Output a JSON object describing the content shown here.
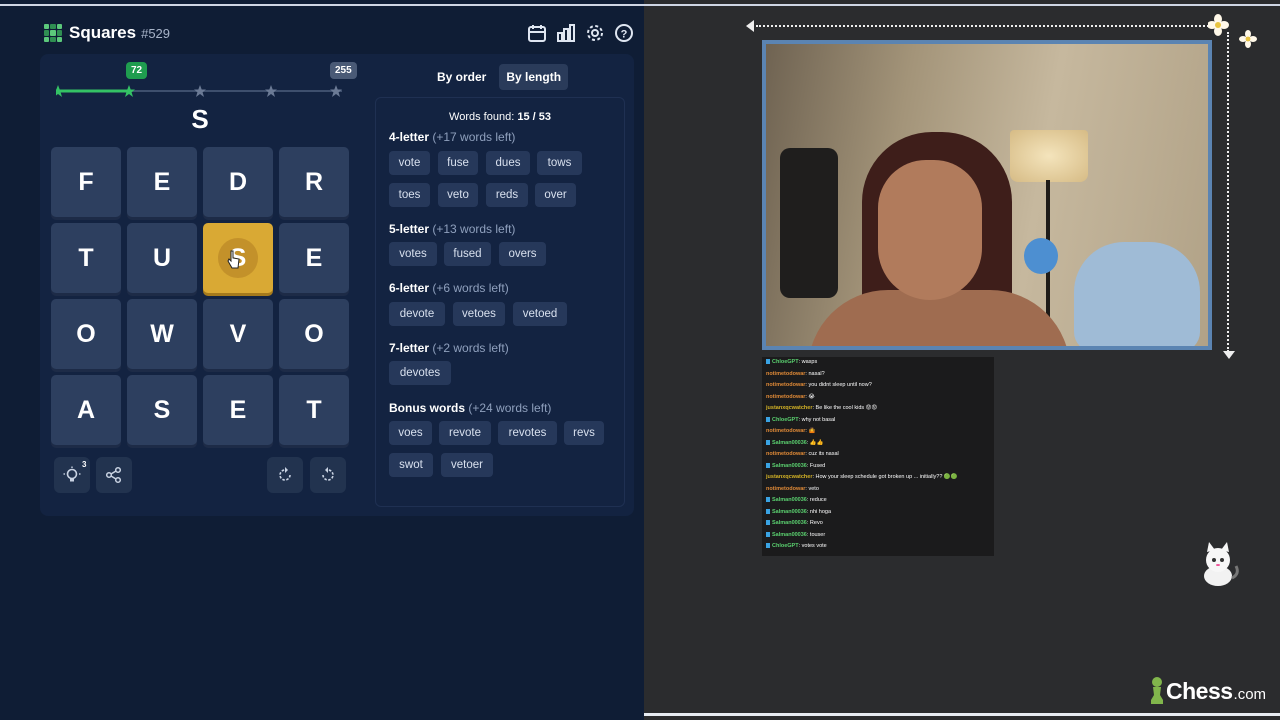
{
  "game": {
    "title": "Squares",
    "number": "#529",
    "progress": {
      "current_score": "72",
      "max_score": "255"
    },
    "current_word": "S",
    "grid": [
      [
        "F",
        "E",
        "D",
        "R"
      ],
      [
        "T",
        "U",
        "S",
        "E"
      ],
      [
        "O",
        "W",
        "V",
        "O"
      ],
      [
        "A",
        "S",
        "E",
        "T"
      ]
    ],
    "selected_tile": "S",
    "hint_count": "3",
    "tabs": {
      "by_order": "By order",
      "by_length": "By length"
    },
    "found": {
      "label": "Words found:",
      "value": "15 / 53"
    },
    "sections": [
      {
        "title": "4-letter",
        "left": "(+17 words left)",
        "words": [
          "vote",
          "fuse",
          "dues",
          "tows",
          "toes",
          "veto",
          "reds",
          "over"
        ]
      },
      {
        "title": "5-letter",
        "left": "(+13 words left)",
        "words": [
          "votes",
          "fused",
          "overs"
        ]
      },
      {
        "title": "6-letter",
        "left": "(+6 words left)",
        "words": [
          "devote",
          "vetoes",
          "vetoed"
        ]
      },
      {
        "title": "7-letter",
        "left": "(+2 words left)",
        "words": [
          "devotes"
        ]
      },
      {
        "title": "Bonus words",
        "left": "(+24 words left)",
        "words": [
          "voes",
          "revote",
          "revotes",
          "revs",
          "swot",
          "vetoer"
        ]
      }
    ]
  },
  "chat": [
    {
      "user": "ChloeGPT",
      "text": ": wasps",
      "color": "#5ad06f",
      "badge": true
    },
    {
      "user": "notimetodowar",
      "text": ": nasal?",
      "color": "#e08a37"
    },
    {
      "user": "notimetodowar",
      "text": ": you didnt sleep until now?",
      "color": "#e08a37"
    },
    {
      "user": "notimetodowar",
      "text": ": 😭",
      "color": "#e08a37"
    },
    {
      "user": "justanxqcwatcher",
      "text": ": Be like the cool kids 😡😡",
      "color": "#d4b326"
    },
    {
      "user": "ChloeGPT",
      "text": ": why not basal",
      "color": "#5ad06f",
      "badge": true
    },
    {
      "user": "notimetodowar",
      "text": ": 🤷",
      "color": "#e08a37"
    },
    {
      "user": "Salman00036",
      "text": ": 👍👍",
      "color": "#5ad06f",
      "badge": true
    },
    {
      "user": "notimetodowar",
      "text": ": cuz its nasal",
      "color": "#e08a37"
    },
    {
      "user": "Salman00036",
      "text": ": Fused",
      "color": "#5ad06f",
      "badge": true
    },
    {
      "user": "justanxqcwatcher",
      "text": ": How your sleep schedule got broken up ... initially?? 🟢🟢",
      "color": "#d4b326"
    },
    {
      "user": "notimetodowar",
      "text": ": veto",
      "color": "#e08a37"
    },
    {
      "user": "Salman00036",
      "text": ": reduce",
      "color": "#5ad06f",
      "badge": true
    },
    {
      "user": "Salman00036",
      "text": ": nhi hoga",
      "color": "#5ad06f",
      "badge": true
    },
    {
      "user": "Salman00036",
      "text": ": Revo",
      "color": "#5ad06f",
      "badge": true
    },
    {
      "user": "Salman00036",
      "text": ": touser",
      "color": "#5ad06f",
      "badge": true
    },
    {
      "user": "ChloeGPT",
      "text": ": votes vote",
      "color": "#5ad06f",
      "badge": true
    }
  ],
  "brand": {
    "name": "Chess",
    "domain": ".com"
  },
  "colors": {
    "tile": "#2d3f5f",
    "selected_tile": "#d9a934",
    "accent_green": "#1f9d4f",
    "cam_border": "#5b84b2"
  }
}
